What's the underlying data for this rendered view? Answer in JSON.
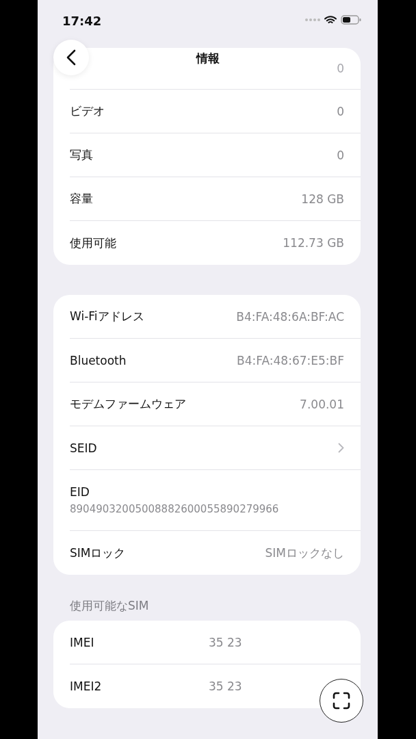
{
  "status_bar": {
    "time": "17:42"
  },
  "nav": {
    "title": "情報"
  },
  "sections": [
    {
      "partial_value": "0",
      "rows": [
        {
          "kind": "value",
          "label": "ビデオ",
          "value": "0"
        },
        {
          "kind": "value",
          "label": "写真",
          "value": "0"
        },
        {
          "kind": "value",
          "label": "容量",
          "value": "128 GB"
        },
        {
          "kind": "value",
          "label": "使用可能",
          "value": "112.73 GB"
        }
      ]
    },
    {
      "rows": [
        {
          "kind": "value",
          "label": "Wi-Fiアドレス",
          "value": "B4:FA:48:6A:BF:AC"
        },
        {
          "kind": "value",
          "label": "Bluetooth",
          "value": "B4:FA:48:67:E5:BF"
        },
        {
          "kind": "value",
          "label": "モデムファームウェア",
          "value": "7.00.01"
        },
        {
          "kind": "link",
          "label": "SEID"
        },
        {
          "kind": "stacked",
          "label": "EID",
          "value": "89049032005008882600055890279966"
        },
        {
          "kind": "value",
          "label": "SIMロック",
          "value": "SIMロックなし"
        }
      ]
    },
    {
      "header": "使用可能なSIM",
      "rows": [
        {
          "kind": "split",
          "label": "IMEI",
          "value": "35 23"
        },
        {
          "kind": "split",
          "label": "IMEI2",
          "value": "35 23"
        }
      ]
    }
  ]
}
